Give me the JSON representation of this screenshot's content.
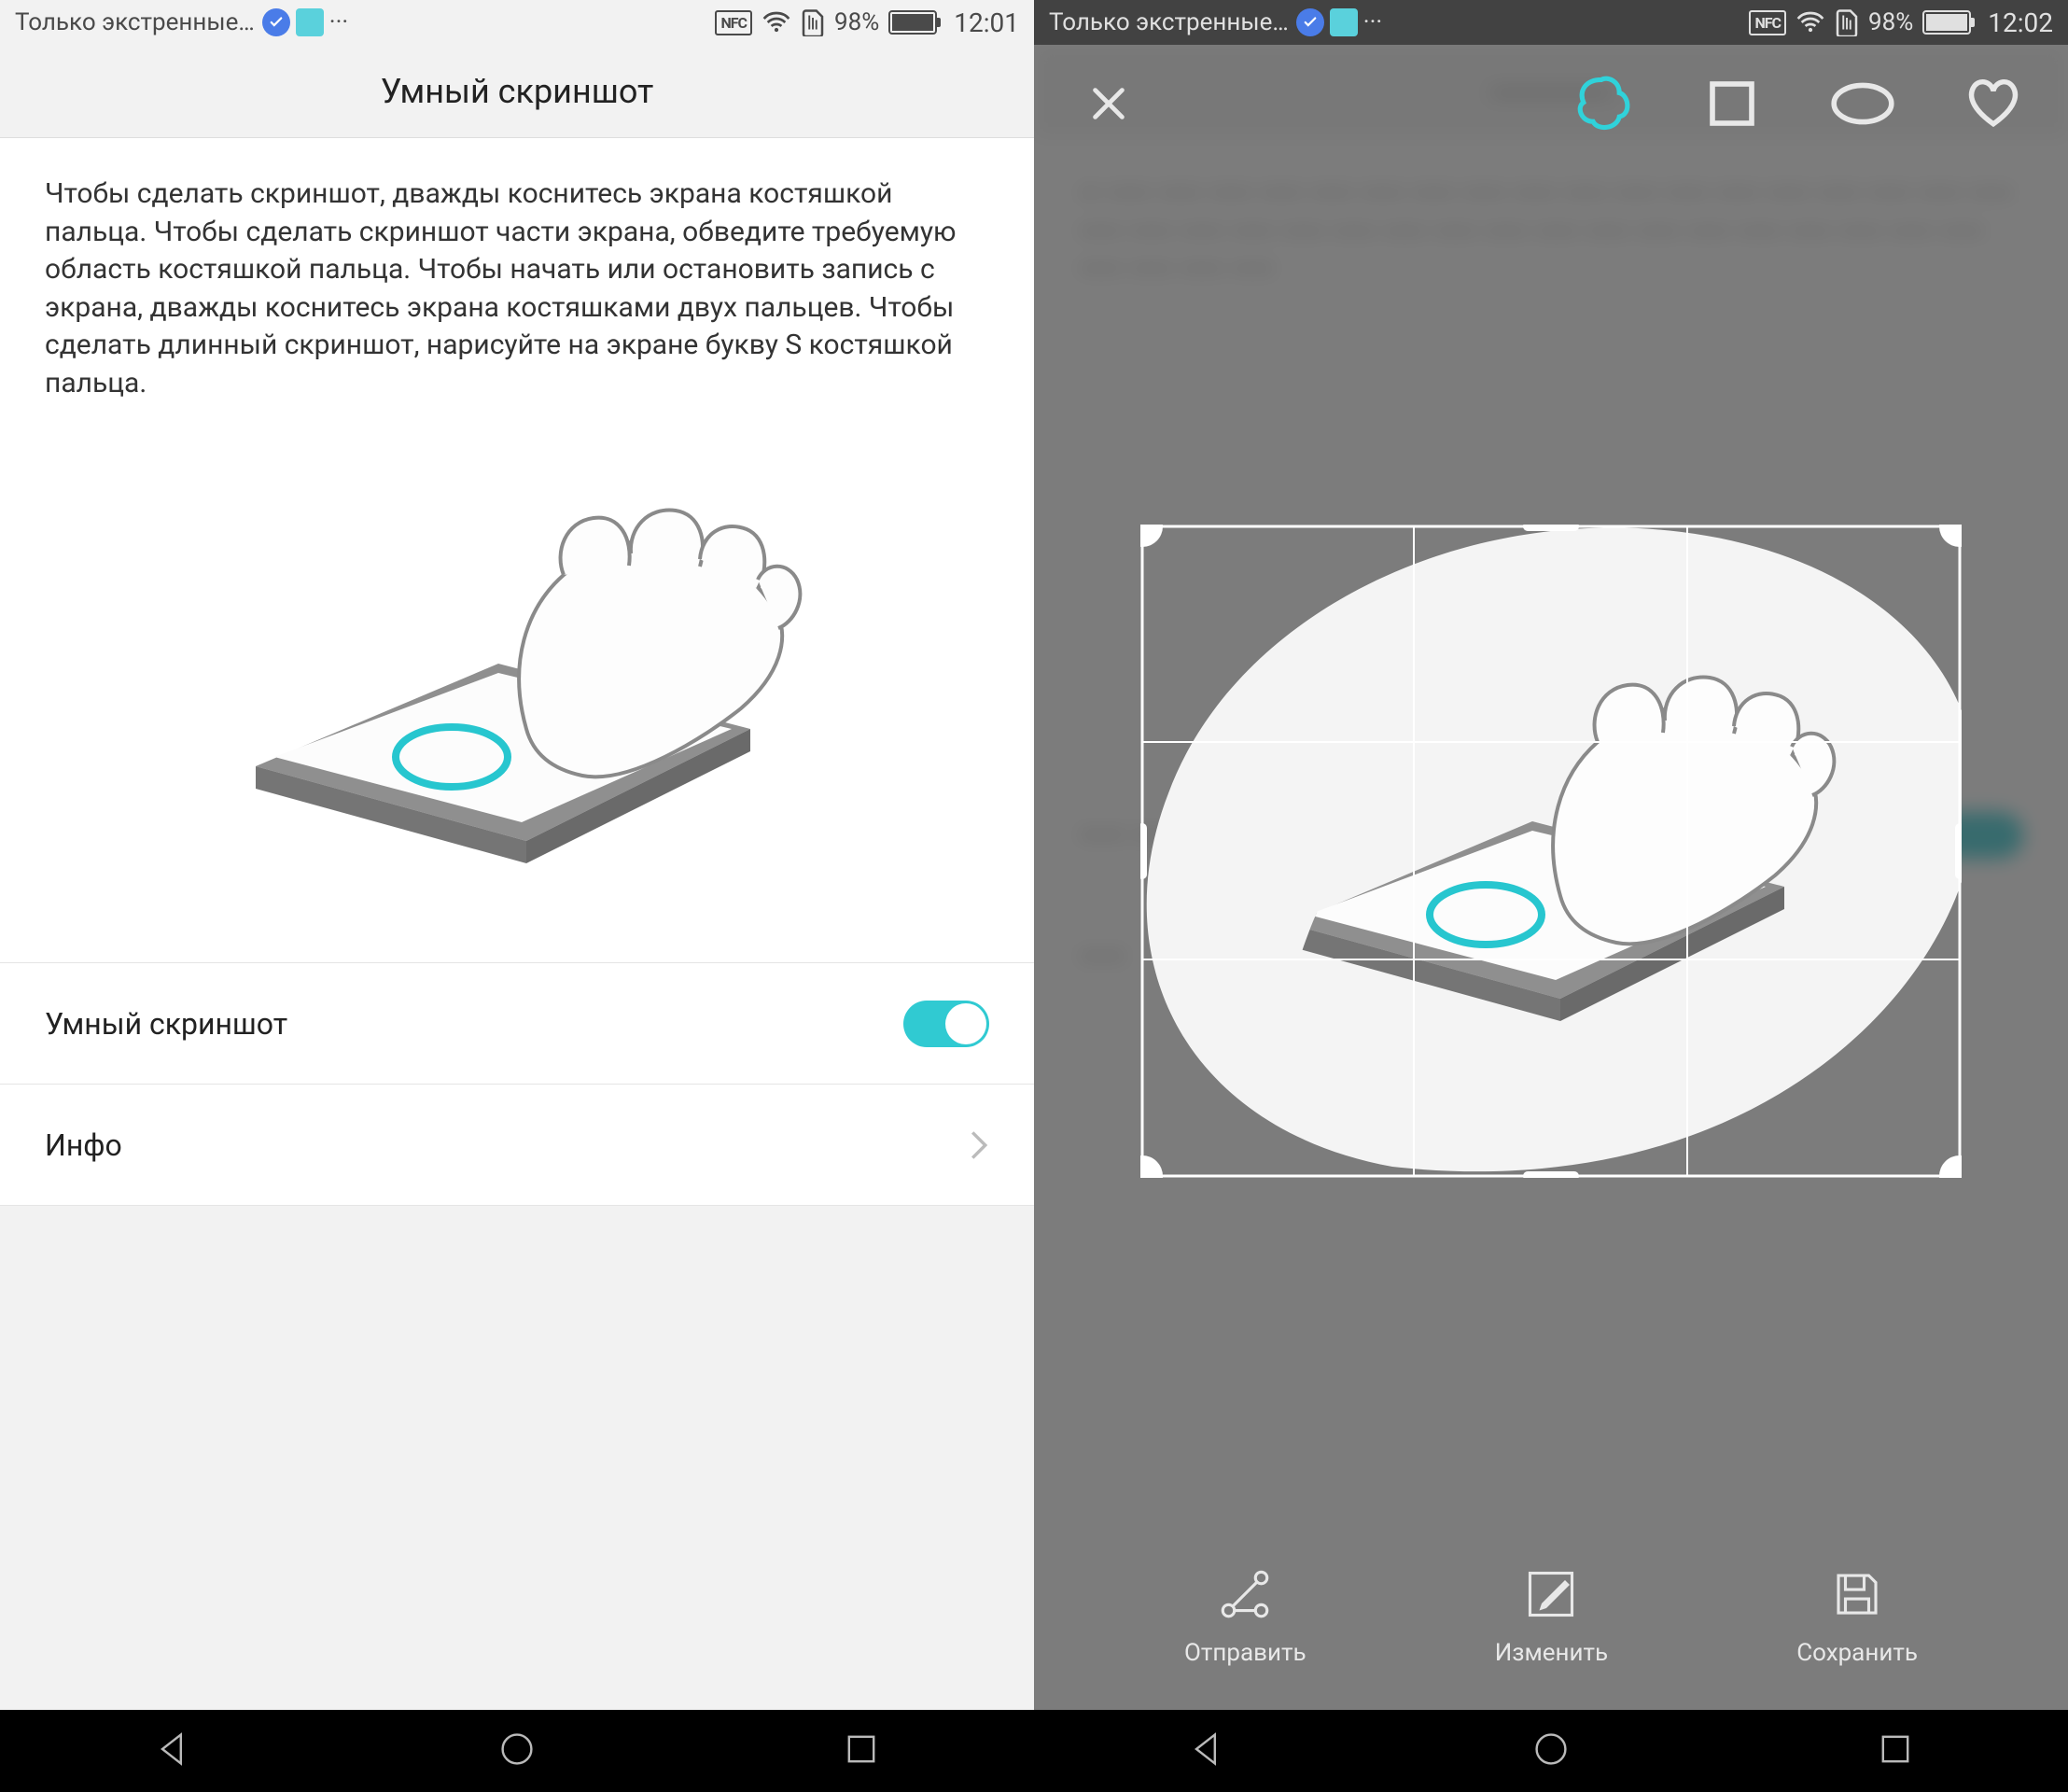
{
  "left": {
    "status": {
      "carrier": "Только экстренные…",
      "battery_percent": "98%",
      "time": "12:01",
      "nfc": "NFC"
    },
    "header": {
      "title": "Умный скриншот"
    },
    "info_text": "Чтобы сделать скриншот, дважды коснитесь экрана костяшкой пальца. Чтобы сделать скриншот части экрана, обведите требуемую область костяшкой пальца. Чтобы начать или остановить запись с экрана, дважды коснитесь экрана костяшками двух пальцев. Чтобы сделать длинный скриншот, нарисуйте на экране букву S костяшкой пальца.",
    "settings": {
      "smart_screenshot": {
        "label": "Умный скриншот",
        "enabled": true
      },
      "info": {
        "label": "Инфо"
      }
    }
  },
  "right": {
    "status": {
      "carrier": "Только экстренные…",
      "battery_percent": "98%",
      "time": "12:02",
      "nfc": "NFC"
    },
    "toolbar_shapes": [
      "freeform",
      "rectangle",
      "oval",
      "heart"
    ],
    "actions": {
      "share": "Отправить",
      "edit": "Изменить",
      "save": "Сохранить"
    }
  },
  "colors": {
    "accent": "#30cad2"
  }
}
